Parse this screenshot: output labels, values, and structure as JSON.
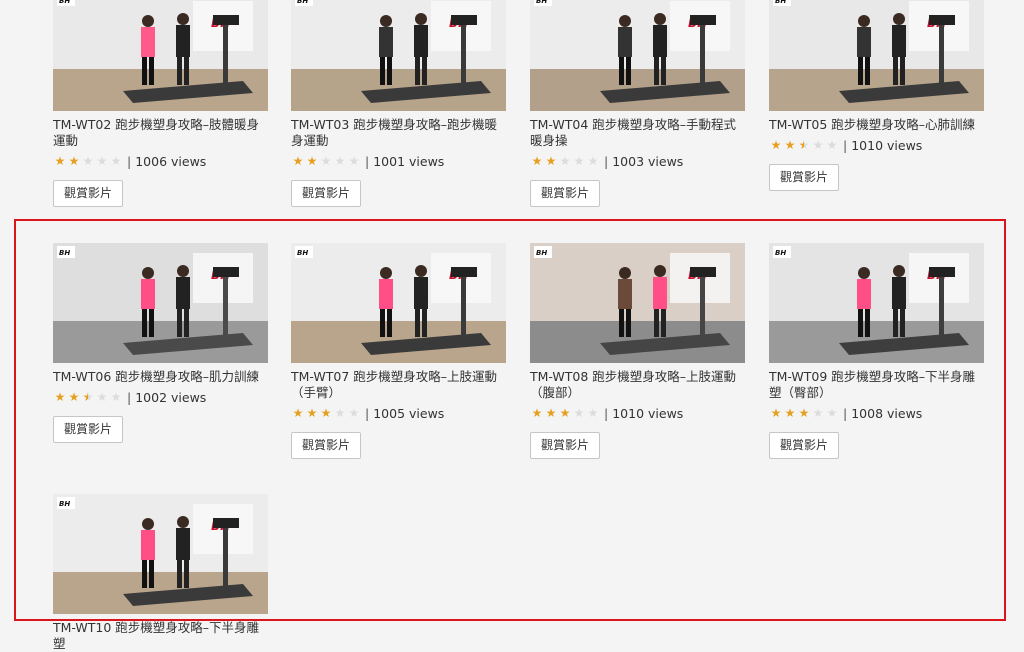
{
  "button_label": "觀賞影片",
  "videos": [
    {
      "title": "TM-WT02 跑步機塑身攻略–肢體暖身運動",
      "rating": 2,
      "views": "1006 views"
    },
    {
      "title": "TM-WT03 跑步機塑身攻略–跑步機暖身運動",
      "rating": 2,
      "views": "1001 views"
    },
    {
      "title": "TM-WT04 跑步機塑身攻略–手動程式暖身操",
      "rating": 2,
      "views": "1003 views"
    },
    {
      "title": "TM-WT05 跑步機塑身攻略–心肺訓練",
      "rating": 2.5,
      "views": "1010 views"
    },
    {
      "title": "TM-WT06 跑步機塑身攻略–肌力訓練",
      "rating": 2.5,
      "views": "1002 views"
    },
    {
      "title": "TM-WT07 跑步機塑身攻略–上肢運動（手臂）",
      "rating": 3,
      "views": "1005 views"
    },
    {
      "title": "TM-WT08 跑步機塑身攻略–上肢運動（腹部）",
      "rating": 3,
      "views": "1010 views"
    },
    {
      "title": "TM-WT09 跑步機塑身攻略–下半身雕塑（臀部）",
      "rating": 3,
      "views": "1008 views"
    },
    {
      "title": "TM-WT10 跑步機塑身攻略–下半身雕塑"
    }
  ],
  "logo_text": "BH",
  "colors": {
    "star": "#e6a01f",
    "star_off": "#dcdcdc",
    "highlight": "#d9151b",
    "background": "#f4f4f4"
  }
}
